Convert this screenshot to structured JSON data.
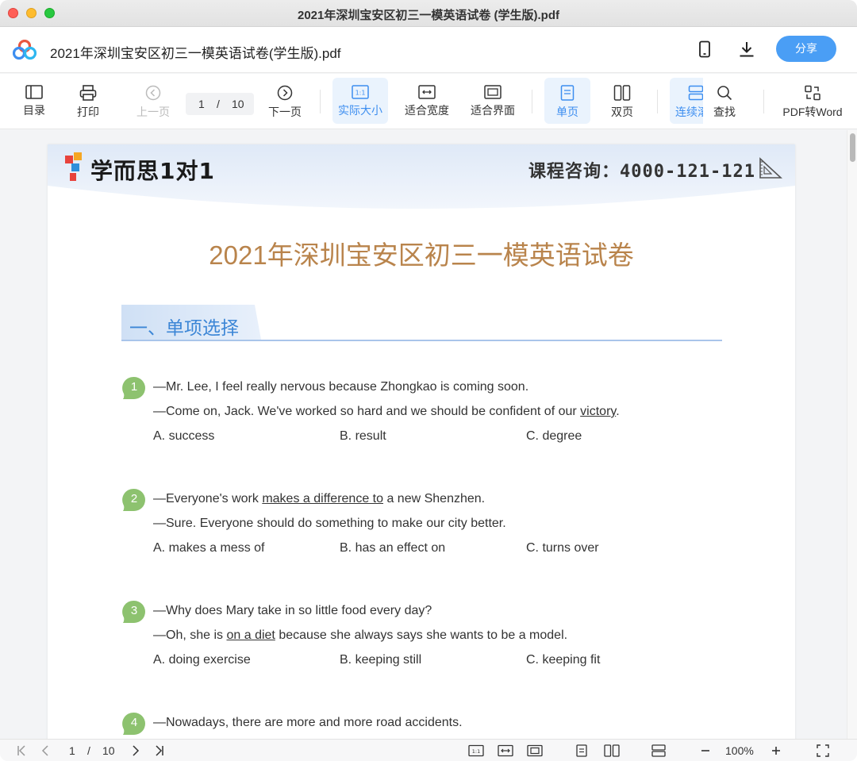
{
  "window": {
    "title": "2021年深圳宝安区初三一模英语试卷 (学生版).pdf"
  },
  "header": {
    "doc_title": "2021年深圳宝安区初三一模英语试卷(学生版).pdf",
    "share_label": "分享"
  },
  "toolbar": {
    "toc": "目录",
    "print": "打印",
    "prev": "上一页",
    "page_current": "1",
    "page_sep": "/",
    "page_total": "10",
    "next": "下一页",
    "actual_size": "实际大小",
    "fit_width": "适合宽度",
    "fit_page": "适合界面",
    "single": "单页",
    "double": "双页",
    "continuous": "连续滚",
    "search": "查找",
    "pdf_to_word": "PDF转Word"
  },
  "page": {
    "brand": "学而思1对1",
    "consult_label": "课程咨询：",
    "consult_number": "4000-121-121",
    "exam_title": "2021年深圳宝安区初三一模英语试卷",
    "section_title": "一、单项选择",
    "questions": [
      {
        "num": "1",
        "line1": "—Mr. Lee, I feel really nervous because Zhongkao is coming soon.",
        "line2_pre": "—Come on, Jack. We've worked so hard and we should be confident of our ",
        "line2_u": "victory",
        "line2_post": ".",
        "options": [
          "A.  success",
          "B.  result",
          "C.  degree"
        ]
      },
      {
        "num": "2",
        "line1_pre": "—Everyone's work ",
        "line1_u": "makes a difference to",
        "line1_post": " a new Shenzhen.",
        "line2": "—Sure. Everyone should do something to make our city better.",
        "options": [
          "A.  makes a mess of",
          "B.  has an effect on",
          "C.  turns over"
        ]
      },
      {
        "num": "3",
        "line1": "—Why does Mary take in so little food every day?",
        "line2_pre": "—Oh, she is ",
        "line2_u": "on a diet",
        "line2_post": " because she always says she wants to be a model.",
        "options": [
          "A.  doing exercise",
          "B.  keeping still",
          "C.  keeping fit"
        ]
      },
      {
        "num": "4",
        "line1": "—Nowadays, there are more and more road accidents."
      }
    ]
  },
  "statusbar": {
    "page_current": "1",
    "page_sep": "/",
    "page_total": "10",
    "zoom": "100%"
  },
  "colors": {
    "accent": "#3d8ef0",
    "share": "#4a9ef5",
    "title_brown": "#b9844c",
    "section_blue": "#3c86d6",
    "qnum_green": "#8dc26f"
  }
}
